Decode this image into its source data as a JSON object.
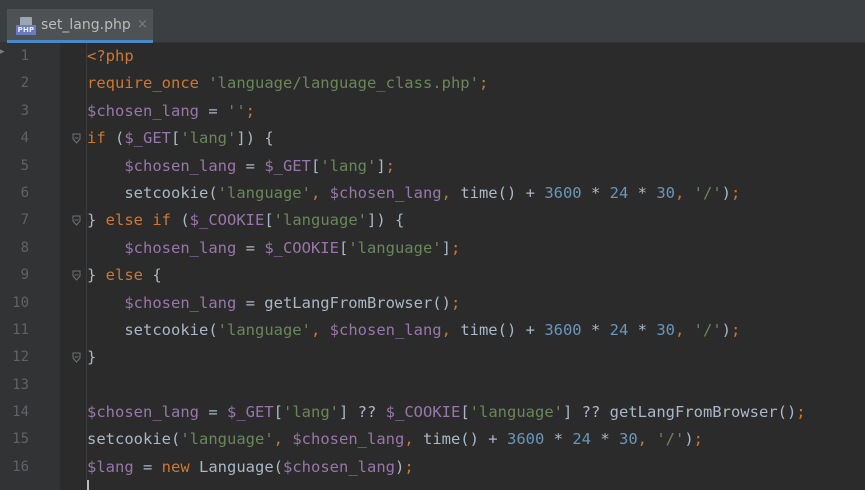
{
  "tab": {
    "title": "set_lang.php",
    "icon_badge": "PHP",
    "close": "×"
  },
  "colors": {
    "keyword": "#cc7832",
    "variable": "#9876aa",
    "string": "#6a8759",
    "number": "#6897bb",
    "text": "#a9b7c6"
  },
  "code_lines": [
    {
      "n": "1",
      "fold": false,
      "tokens": [
        [
          "k",
          "<?php"
        ]
      ]
    },
    {
      "n": "2",
      "fold": false,
      "tokens": [
        [
          "k",
          "require_once "
        ],
        [
          "s",
          "'language/language_class.php'"
        ],
        [
          "k",
          ";"
        ]
      ]
    },
    {
      "n": "3",
      "fold": false,
      "tokens": [
        [
          "v",
          "$chosen_lang"
        ],
        [
          "t",
          " = "
        ],
        [
          "s",
          "''"
        ],
        [
          "k",
          ";"
        ]
      ]
    },
    {
      "n": "4",
      "fold": true,
      "tokens": [
        [
          "k",
          "if "
        ],
        [
          "t",
          "("
        ],
        [
          "v",
          "$_GET"
        ],
        [
          "t",
          "["
        ],
        [
          "s",
          "'lang'"
        ],
        [
          "t",
          "]) {"
        ]
      ]
    },
    {
      "n": "5",
      "fold": false,
      "tokens": [
        [
          "t",
          "    "
        ],
        [
          "v",
          "$chosen_lang"
        ],
        [
          "t",
          " = "
        ],
        [
          "v",
          "$_GET"
        ],
        [
          "t",
          "["
        ],
        [
          "s",
          "'lang'"
        ],
        [
          "t",
          "]"
        ],
        [
          "k",
          ";"
        ]
      ]
    },
    {
      "n": "6",
      "fold": false,
      "tokens": [
        [
          "t",
          "    setcookie("
        ],
        [
          "s",
          "'language'"
        ],
        [
          "k",
          ", "
        ],
        [
          "v",
          "$chosen_lang"
        ],
        [
          "k",
          ", "
        ],
        [
          "t",
          "time() + "
        ],
        [
          "n",
          "3600"
        ],
        [
          "t",
          " * "
        ],
        [
          "n",
          "24"
        ],
        [
          "t",
          " * "
        ],
        [
          "n",
          "30"
        ],
        [
          "k",
          ", "
        ],
        [
          "s",
          "'/'"
        ],
        [
          "t",
          ")"
        ],
        [
          "k",
          ";"
        ]
      ]
    },
    {
      "n": "7",
      "fold": true,
      "tokens": [
        [
          "t",
          "} "
        ],
        [
          "k",
          "else if "
        ],
        [
          "t",
          "("
        ],
        [
          "v",
          "$_COOKIE"
        ],
        [
          "t",
          "["
        ],
        [
          "s",
          "'language'"
        ],
        [
          "t",
          "]) {"
        ]
      ]
    },
    {
      "n": "8",
      "fold": false,
      "tokens": [
        [
          "t",
          "    "
        ],
        [
          "v",
          "$chosen_lang"
        ],
        [
          "t",
          " = "
        ],
        [
          "v",
          "$_COOKIE"
        ],
        [
          "t",
          "["
        ],
        [
          "s",
          "'language'"
        ],
        [
          "t",
          "]"
        ],
        [
          "k",
          ";"
        ]
      ]
    },
    {
      "n": "9",
      "fold": true,
      "tokens": [
        [
          "t",
          "} "
        ],
        [
          "k",
          "else "
        ],
        [
          "t",
          "{"
        ]
      ]
    },
    {
      "n": "10",
      "fold": false,
      "tokens": [
        [
          "t",
          "    "
        ],
        [
          "v",
          "$chosen_lang"
        ],
        [
          "t",
          " = getLangFromBrowser()"
        ],
        [
          "k",
          ";"
        ]
      ]
    },
    {
      "n": "11",
      "fold": false,
      "tokens": [
        [
          "t",
          "    setcookie("
        ],
        [
          "s",
          "'language'"
        ],
        [
          "k",
          ", "
        ],
        [
          "v",
          "$chosen_lang"
        ],
        [
          "k",
          ", "
        ],
        [
          "t",
          "time() + "
        ],
        [
          "n",
          "3600"
        ],
        [
          "t",
          " * "
        ],
        [
          "n",
          "24"
        ],
        [
          "t",
          " * "
        ],
        [
          "n",
          "30"
        ],
        [
          "k",
          ", "
        ],
        [
          "s",
          "'/'"
        ],
        [
          "t",
          ")"
        ],
        [
          "k",
          ";"
        ]
      ]
    },
    {
      "n": "12",
      "fold": true,
      "tokens": [
        [
          "t",
          "}"
        ]
      ]
    },
    {
      "n": "13",
      "fold": false,
      "tokens": []
    },
    {
      "n": "14",
      "fold": false,
      "tokens": [
        [
          "v",
          "$chosen_lang"
        ],
        [
          "t",
          " = "
        ],
        [
          "v",
          "$_GET"
        ],
        [
          "t",
          "["
        ],
        [
          "s",
          "'lang'"
        ],
        [
          "t",
          "] ?? "
        ],
        [
          "v",
          "$_COOKIE"
        ],
        [
          "t",
          "["
        ],
        [
          "s",
          "'language'"
        ],
        [
          "t",
          "] ?? getLangFromBrowser()"
        ],
        [
          "k",
          ";"
        ]
      ]
    },
    {
      "n": "15",
      "fold": false,
      "tokens": [
        [
          "t",
          "setcookie("
        ],
        [
          "s",
          "'language'"
        ],
        [
          "k",
          ", "
        ],
        [
          "v",
          "$chosen_lang"
        ],
        [
          "k",
          ", "
        ],
        [
          "t",
          "time() + "
        ],
        [
          "n",
          "3600"
        ],
        [
          "t",
          " * "
        ],
        [
          "n",
          "24"
        ],
        [
          "t",
          " * "
        ],
        [
          "n",
          "30"
        ],
        [
          "k",
          ", "
        ],
        [
          "s",
          "'/'"
        ],
        [
          "t",
          ")"
        ],
        [
          "k",
          ";"
        ]
      ]
    },
    {
      "n": "16",
      "fold": false,
      "tokens": [
        [
          "v",
          "$lang"
        ],
        [
          "t",
          " = "
        ],
        [
          "k",
          "new "
        ],
        [
          "t",
          "Language("
        ],
        [
          "v",
          "$chosen_lang"
        ],
        [
          "t",
          ")"
        ],
        [
          "k",
          ";"
        ]
      ]
    }
  ]
}
